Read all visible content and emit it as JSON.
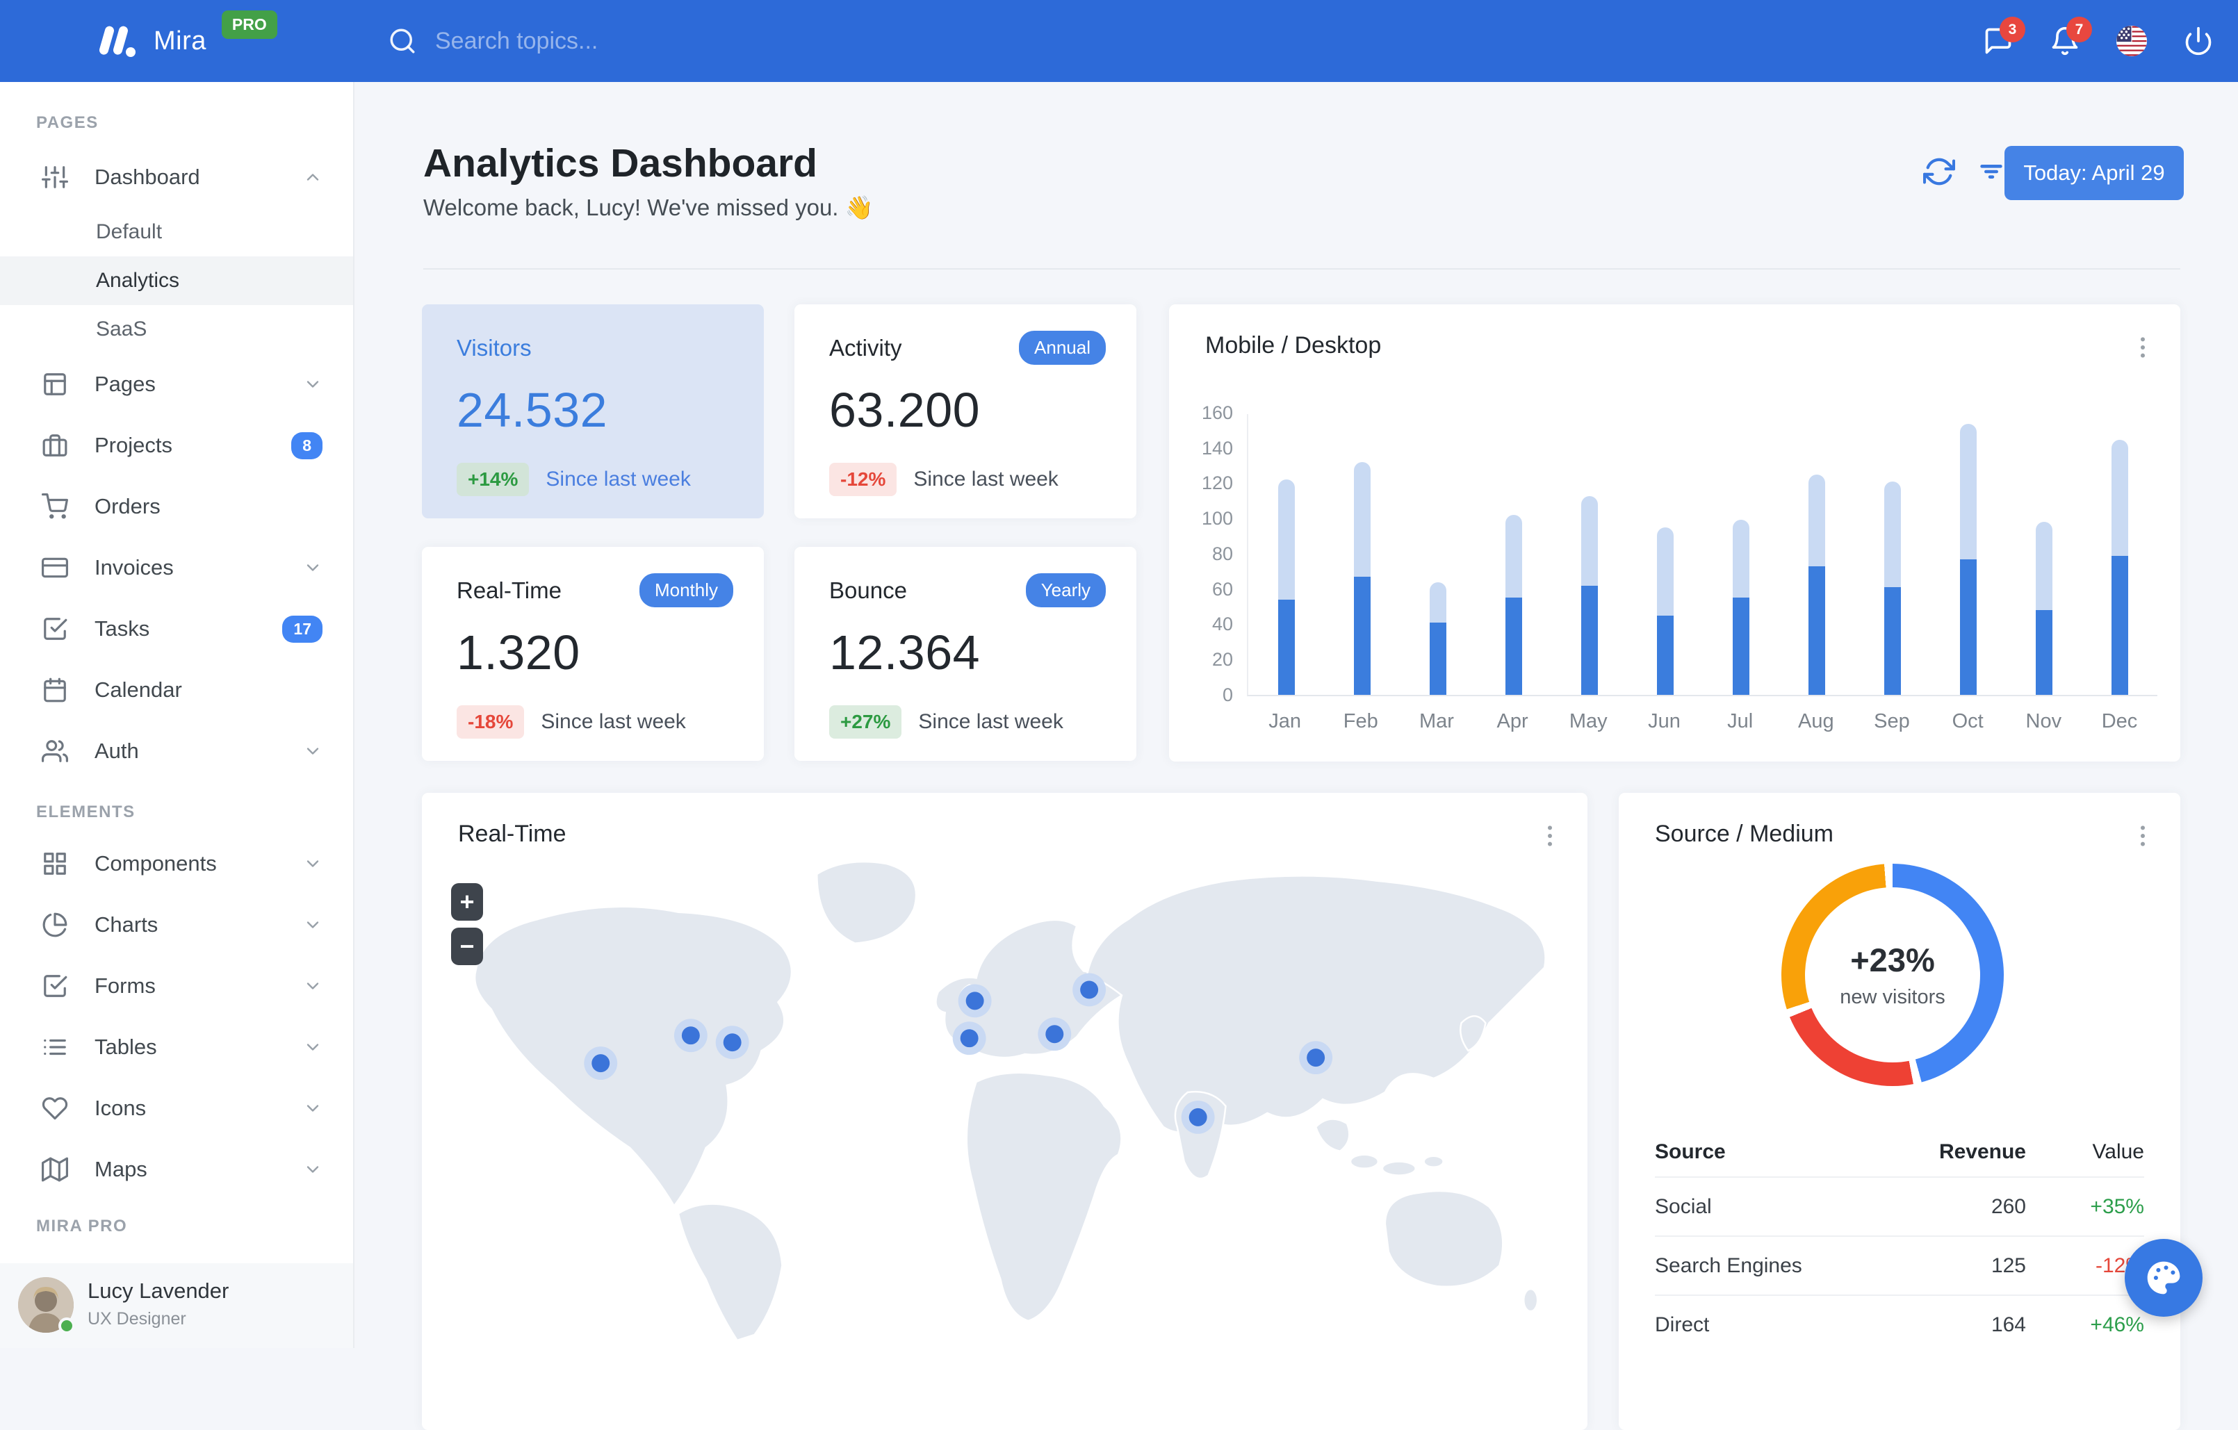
{
  "navbar": {
    "brand": "Mira",
    "brand_badge": "PRO",
    "search_placeholder": "Search topics...",
    "messages_badge": "3",
    "alerts_badge": "7",
    "colors": {
      "bar": "#2d6ad8",
      "badge": "#e8473f",
      "pro": "#43a047"
    }
  },
  "sidebar": {
    "sections": [
      {
        "label": "PAGES",
        "items": [
          {
            "label": "Dashboard",
            "icon": "sliders",
            "chevron": "up",
            "children": [
              {
                "label": "Default",
                "active": false
              },
              {
                "label": "Analytics",
                "active": true
              },
              {
                "label": "SaaS",
                "active": false
              }
            ]
          },
          {
            "label": "Pages",
            "icon": "layout",
            "chevron": "down"
          },
          {
            "label": "Projects",
            "icon": "briefcase",
            "badge": "8"
          },
          {
            "label": "Orders",
            "icon": "shopping-cart"
          },
          {
            "label": "Invoices",
            "icon": "credit-card",
            "chevron": "down"
          },
          {
            "label": "Tasks",
            "icon": "check-square",
            "badge": "17"
          },
          {
            "label": "Calendar",
            "icon": "calendar"
          },
          {
            "label": "Auth",
            "icon": "users",
            "chevron": "down"
          }
        ]
      },
      {
        "label": "ELEMENTS",
        "items": [
          {
            "label": "Components",
            "icon": "grid",
            "chevron": "down"
          },
          {
            "label": "Charts",
            "icon": "pie-chart",
            "chevron": "down"
          },
          {
            "label": "Forms",
            "icon": "check-square",
            "chevron": "down"
          },
          {
            "label": "Tables",
            "icon": "list",
            "chevron": "down"
          },
          {
            "label": "Icons",
            "icon": "heart",
            "chevron": "down"
          },
          {
            "label": "Maps",
            "icon": "map",
            "chevron": "down"
          }
        ]
      },
      {
        "label": "MIRA PRO",
        "items": []
      }
    ],
    "user": {
      "name": "Lucy Lavender",
      "role": "UX Designer",
      "status": "online"
    }
  },
  "header": {
    "title": "Analytics Dashboard",
    "subtitle": "Welcome back, Lucy! We've missed you. 👋",
    "today_label": "Today: April 29",
    "action_icons": [
      "refresh-icon",
      "filter-icon"
    ]
  },
  "stats": [
    {
      "title": "Visitors",
      "value": "24.532",
      "badge": null,
      "delta": "+14%",
      "delta_dir": "up",
      "caption": "Since last week",
      "variant": "primary"
    },
    {
      "title": "Activity",
      "value": "63.200",
      "badge": "Annual",
      "delta": "-12%",
      "delta_dir": "down",
      "caption": "Since last week",
      "variant": "default"
    },
    {
      "title": "Real-Time",
      "value": "1.320",
      "badge": "Monthly",
      "delta": "-18%",
      "delta_dir": "down",
      "caption": "Since last week",
      "variant": "default"
    },
    {
      "title": "Bounce",
      "value": "12.364",
      "badge": "Yearly",
      "delta": "+27%",
      "delta_dir": "up",
      "caption": "Since last week",
      "variant": "default"
    }
  ],
  "chart_data": [
    {
      "type": "bar",
      "title": "Mobile / Desktop",
      "stacked": true,
      "categories": [
        "Jan",
        "Feb",
        "Mar",
        "Apr",
        "May",
        "Jun",
        "Jul",
        "Aug",
        "Sep",
        "Oct",
        "Nov",
        "Dec"
      ],
      "series": [
        {
          "name": "Mobile",
          "color": "#3b7ddd",
          "values": [
            54,
            67,
            41,
            55,
            62,
            45,
            55,
            73,
            61,
            77,
            48,
            79
          ]
        },
        {
          "name": "Desktop",
          "color": "#c9daf3",
          "values": [
            68,
            65,
            23,
            47,
            51,
            50,
            44,
            52,
            60,
            77,
            50,
            66
          ]
        }
      ],
      "ylim": [
        0,
        160
      ],
      "y_ticks": [
        0,
        20,
        40,
        60,
        80,
        100,
        120,
        140,
        160
      ],
      "grid": false,
      "legend": "none"
    },
    {
      "type": "pie",
      "title": "Source / Medium",
      "donut": true,
      "center_value": "+23%",
      "center_label": "new visitors",
      "segments": [
        {
          "label": "Social",
          "value": 260,
          "pct": 47,
          "color": "#4285f4"
        },
        {
          "label": "Search Engines",
          "value": 125,
          "pct": 23,
          "color": "#ee4134"
        },
        {
          "label": "Direct",
          "value": 164,
          "pct": 30,
          "color": "#f9a109"
        }
      ]
    }
  ],
  "realtime_map": {
    "title": "Real-Time",
    "zoom_in_label": "+",
    "zoom_out_label": "−",
    "markers": [
      [
        250,
        330
      ],
      [
        380,
        290
      ],
      [
        440,
        300
      ],
      [
        790,
        240
      ],
      [
        782,
        294
      ],
      [
        905,
        288
      ],
      [
        955,
        224
      ],
      [
        1112,
        408
      ],
      [
        1282,
        322
      ]
    ],
    "marker_color": "#3b74d9"
  },
  "source_medium": {
    "title": "Source / Medium",
    "headers": [
      "Source",
      "Revenue",
      "Value"
    ],
    "rows": [
      {
        "source": "Social",
        "revenue": "260",
        "value": "+35%",
        "dir": "up"
      },
      {
        "source": "Search Engines",
        "revenue": "125",
        "value": "-12%",
        "dir": "down"
      },
      {
        "source": "Direct",
        "revenue": "164",
        "value": "+46%",
        "dir": "up"
      }
    ]
  },
  "fab": {
    "icon": "palette-icon",
    "color": "#3779e3"
  }
}
